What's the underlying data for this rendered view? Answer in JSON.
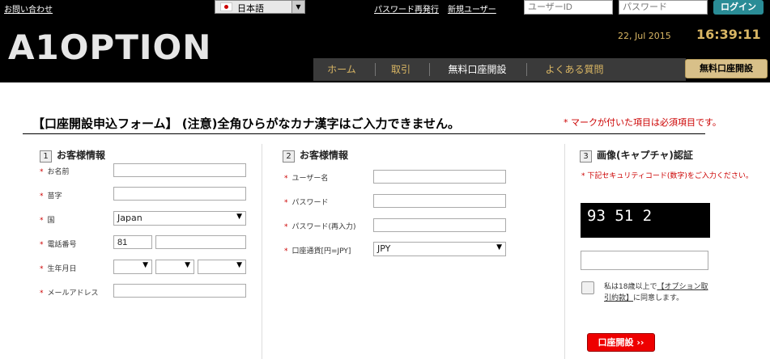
{
  "topbar": {
    "contact": "お問い合わせ",
    "language": "日本語",
    "password_reset": "パスワード再発行",
    "new_user": "新規ユーザー",
    "userid_placeholder": "ユーザーID",
    "password_placeholder": "パスワード",
    "login": "ログイン"
  },
  "header": {
    "logo": "A1OPTION",
    "date": "22, Jul 2015",
    "time": "16:39:11",
    "nav": [
      "ホーム",
      "取引",
      "無料口座開設",
      "よくある質問"
    ],
    "nav_button": "無料口座開設"
  },
  "form": {
    "title": "【口座開設申込フォーム】 (注意)全角ひらがなカナ漢字はご入力できません。",
    "required_note": "* マークが付いた項目は必須項目です。",
    "asterisk": "*",
    "section1": {
      "number": "1",
      "title": "お客様情報",
      "name_label": "お名前",
      "surname_label": "苗字",
      "country_label": "国",
      "country_value": "Japan",
      "phone_label": "電話番号",
      "phone_code": "81",
      "dob_label": "生年月日",
      "email_label": "メールアドレス"
    },
    "section2": {
      "number": "2",
      "title": "お客様情報",
      "username_label": "ユーザー名",
      "password_label": "パスワード",
      "password2_label": "パスワード(再入力)",
      "currency_label": "口座通貨[円=JPY]",
      "currency_value": "JPY"
    },
    "section3": {
      "number": "3",
      "title": "画像(キャプチャ)認証",
      "note": "* 下記セキュリティコード(数字)をご入力ください。",
      "captcha_text": "93 51 2",
      "agree_prefix": "私は18歳以上で",
      "agree_link": "【オプション取引約款】",
      "agree_suffix": "に同意します。",
      "submit": "口座開設 ››"
    }
  }
}
